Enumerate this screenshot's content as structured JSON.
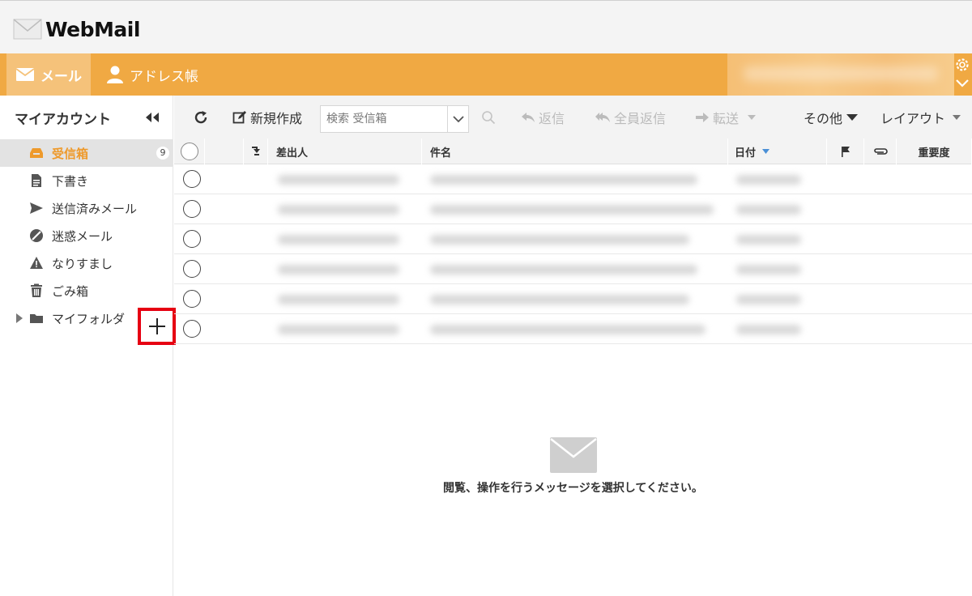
{
  "app": {
    "logo_text": "WebMail"
  },
  "nav": {
    "mail_label": "メール",
    "address_label": "アドレス帳"
  },
  "sidebar": {
    "title": "マイアカウント",
    "folders": [
      {
        "label": "受信箱",
        "count": "9"
      },
      {
        "label": "下書き"
      },
      {
        "label": "送信済みメール"
      },
      {
        "label": "迷惑メール"
      },
      {
        "label": "なりすまし"
      },
      {
        "label": "ごみ箱"
      },
      {
        "label": "マイフォルダ"
      }
    ],
    "add_folder_symbol": "+"
  },
  "toolbar": {
    "compose_label": "新規作成",
    "search_placeholder": "検索 受信箱",
    "reply_label": "返信",
    "reply_all_label": "全員返信",
    "forward_label": "転送",
    "more_label": "その他",
    "layout_label": "レイアウト"
  },
  "list": {
    "columns": {
      "from": "差出人",
      "subject": "件名",
      "date": "日付",
      "importance": "重要度"
    },
    "row_count": 6
  },
  "preview": {
    "empty_message": "閲覧、操作を行うメッセージを選択してください。"
  },
  "colors": {
    "accent": "#f0a943",
    "active_text": "#ee9a2c",
    "highlight": "#e60012"
  }
}
